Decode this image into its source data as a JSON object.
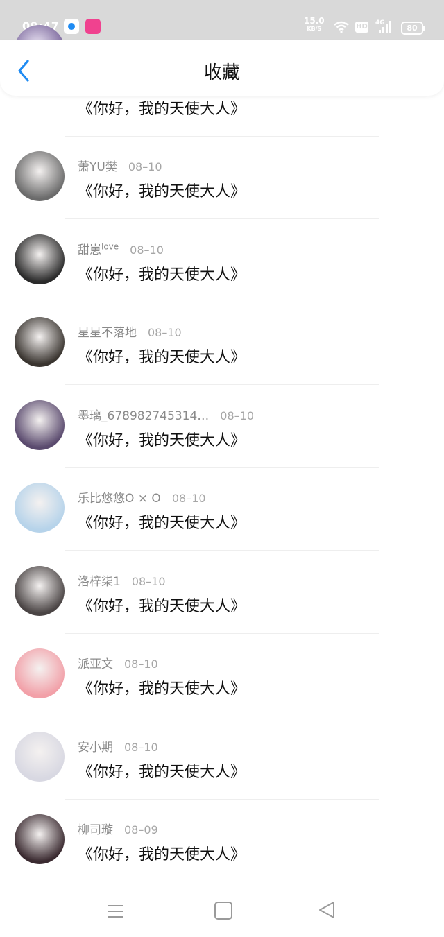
{
  "status_bar": {
    "time": "09:47",
    "speed_value": "15.0",
    "speed_unit": "KB/S",
    "hd": "HD",
    "network": "4G",
    "battery": "80"
  },
  "header": {
    "title": "收藏",
    "back_icon": "chevron-left-icon",
    "accent_color": "#1f8bf3"
  },
  "partial_item": {
    "message": "《你好，我的天使大人》"
  },
  "items": [
    {
      "name": "萧YU樊",
      "date": "08–10",
      "message": "《你好，我的天使大人》",
      "avatar_color": "#6b6b6b"
    },
    {
      "name": "甜崽",
      "name_sup": "love",
      "date": "08–10",
      "message": "《你好，我的天使大人》",
      "avatar_color": "#2b2b2b"
    },
    {
      "name": "星星不落地",
      "date": "08–10",
      "message": "《你好，我的天使大人》",
      "avatar_color": "#3a3530"
    },
    {
      "name": "墨璃_678982745314…",
      "date": "08–10",
      "message": "《你好，我的天使大人》",
      "avatar_color": "#5a4a6e"
    },
    {
      "name": "乐比悠悠O × O",
      "date": "08–10",
      "message": "《你好，我的天使大人》",
      "avatar_color": "#b6d3ea"
    },
    {
      "name": "洛梓柒1",
      "date": "08–10",
      "message": "《你好，我的天使大人》",
      "avatar_color": "#4a4444"
    },
    {
      "name": "派亚文",
      "date": "08–10",
      "message": "《你好，我的天使大人》",
      "avatar_color": "#f2a0a8"
    },
    {
      "name": "安小期",
      "date": "08–10",
      "message": "《你好，我的天使大人》",
      "avatar_color": "#d8d8e2"
    },
    {
      "name": "柳司璇",
      "date": "08–09",
      "message": "《你好，我的天使大人》",
      "avatar_color": "#3a2a30"
    }
  ],
  "nav": {
    "menu_icon": "menu-icon",
    "home_icon": "home-square-icon",
    "back_icon": "back-triangle-icon"
  }
}
